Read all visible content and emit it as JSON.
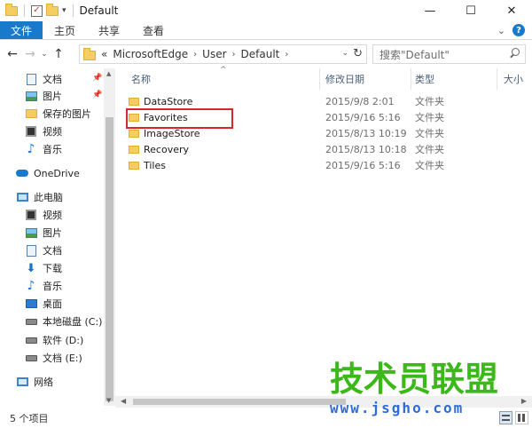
{
  "window": {
    "title": "Default",
    "controls": {
      "minimize": "—",
      "maximize": "☐",
      "close": "✕"
    }
  },
  "ribbon": {
    "tabs": [
      "文件",
      "主页",
      "共享",
      "查看"
    ],
    "expand_icon": "chevron-down-icon",
    "help_icon": "help-icon"
  },
  "navigation": {
    "path": [
      "MicrosoftEdge",
      "User",
      "Default"
    ],
    "path_prefix": "«",
    "search_placeholder": "搜索\"Default\""
  },
  "sidebar": {
    "quick_access": [
      {
        "label": "文档",
        "icon": "documents-icon",
        "pinned": true
      },
      {
        "label": "图片",
        "icon": "pictures-icon",
        "pinned": true
      },
      {
        "label": "保存的图片",
        "icon": "folder-icon",
        "pinned": false
      },
      {
        "label": "视频",
        "icon": "videos-icon",
        "pinned": false
      },
      {
        "label": "音乐",
        "icon": "music-icon",
        "pinned": false
      }
    ],
    "onedrive": {
      "label": "OneDrive",
      "icon": "onedrive-icon"
    },
    "this_pc": {
      "label": "此电脑",
      "icon": "pc-icon",
      "items": [
        {
          "label": "视频",
          "icon": "videos-icon"
        },
        {
          "label": "图片",
          "icon": "pictures-icon"
        },
        {
          "label": "文档",
          "icon": "documents-icon"
        },
        {
          "label": "下载",
          "icon": "downloads-icon"
        },
        {
          "label": "音乐",
          "icon": "music-icon"
        },
        {
          "label": "桌面",
          "icon": "desktop-icon"
        },
        {
          "label": "本地磁盘 (C:)",
          "icon": "drive-icon"
        },
        {
          "label": "软件 (D:)",
          "icon": "drive-icon"
        },
        {
          "label": "文档 (E:)",
          "icon": "drive-icon"
        }
      ]
    },
    "network": {
      "label": "网络",
      "icon": "network-icon"
    }
  },
  "file_list": {
    "columns": [
      "名称",
      "修改日期",
      "类型",
      "大小"
    ],
    "rows": [
      {
        "name": "DataStore",
        "modified": "2015/9/8 2:01",
        "type": "文件夹",
        "highlighted": false
      },
      {
        "name": "Favorites",
        "modified": "2015/9/16 5:16",
        "type": "文件夹",
        "highlighted": true
      },
      {
        "name": "ImageStore",
        "modified": "2015/8/13 10:19",
        "type": "文件夹",
        "highlighted": false
      },
      {
        "name": "Recovery",
        "modified": "2015/8/13 10:18",
        "type": "文件夹",
        "highlighted": false
      },
      {
        "name": "Tiles",
        "modified": "2015/9/16 5:16",
        "type": "文件夹",
        "highlighted": false
      }
    ]
  },
  "status": {
    "item_count": "5 个项目"
  },
  "watermark": {
    "title": "技术员联盟",
    "url": "www.jsgho.com"
  },
  "colors": {
    "accent": "#1979ca",
    "highlight_border": "#d9262a",
    "folder": "#f5cd63",
    "watermark_green": "#3cb81a",
    "watermark_blue": "#2f6bd8"
  }
}
